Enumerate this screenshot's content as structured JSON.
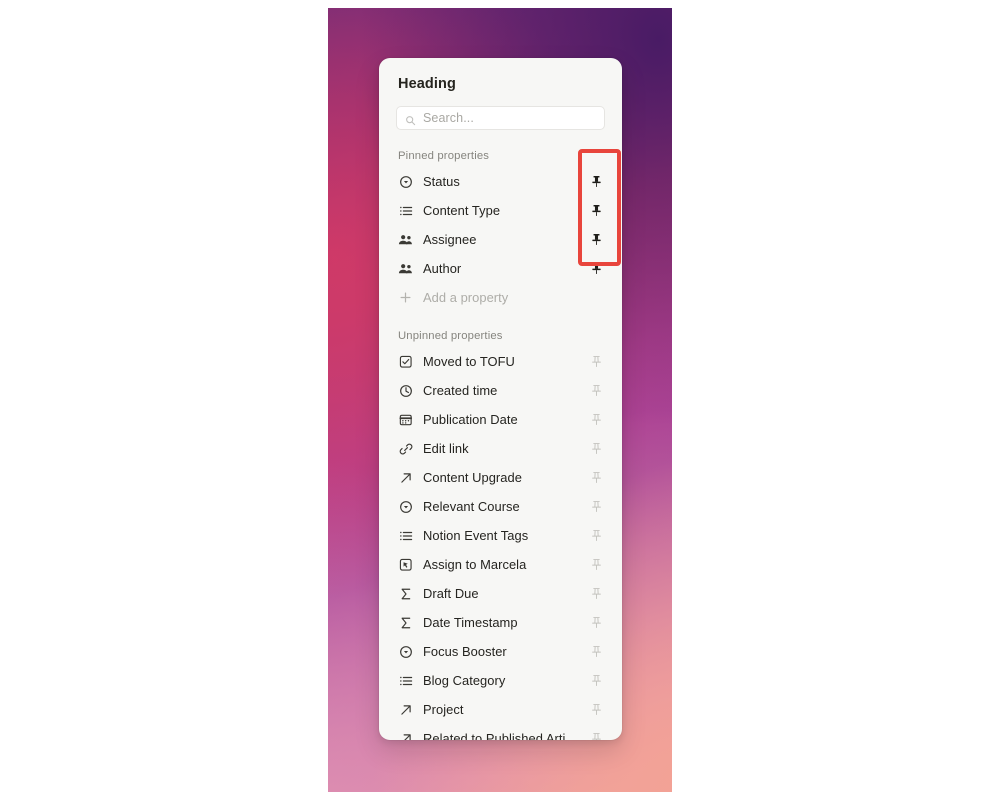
{
  "panel": {
    "heading": "Heading",
    "search": {
      "placeholder": "Search...",
      "value": "",
      "icon": "search-icon"
    },
    "pinned_section_label": "Pinned properties",
    "unpinned_section_label": "Unpinned properties",
    "add_property_label": "Add a property",
    "add_property_icon": "plus-icon"
  },
  "pinned_properties": [
    {
      "label": "Status",
      "icon": "select-icon",
      "pinned": true,
      "pin_icon": "pin-filled-icon"
    },
    {
      "label": "Content Type",
      "icon": "multiselect-icon",
      "pinned": true,
      "pin_icon": "pin-filled-icon"
    },
    {
      "label": "Assignee",
      "icon": "person-icon",
      "pinned": true,
      "pin_icon": "pin-filled-icon"
    },
    {
      "label": "Author",
      "icon": "person-icon",
      "pinned": true,
      "pin_icon": "pin-filled-icon"
    }
  ],
  "unpinned_properties": [
    {
      "label": "Moved to TOFU",
      "icon": "checkbox-icon",
      "pinned": false,
      "pin_icon": "pin-outline-icon"
    },
    {
      "label": "Created time",
      "icon": "clock-icon",
      "pinned": false,
      "pin_icon": "pin-outline-icon"
    },
    {
      "label": "Publication Date",
      "icon": "calendar-icon",
      "pinned": false,
      "pin_icon": "pin-outline-icon"
    },
    {
      "label": "Edit link",
      "icon": "link-icon",
      "pinned": false,
      "pin_icon": "pin-outline-icon"
    },
    {
      "label": "Content Upgrade",
      "icon": "relation-icon",
      "pinned": false,
      "pin_icon": "pin-outline-icon"
    },
    {
      "label": "Relevant Course",
      "icon": "select-icon",
      "pinned": false,
      "pin_icon": "pin-outline-icon"
    },
    {
      "label": "Notion Event Tags",
      "icon": "multiselect-icon",
      "pinned": false,
      "pin_icon": "pin-outline-icon"
    },
    {
      "label": "Assign to Marcela",
      "icon": "button-icon",
      "pinned": false,
      "pin_icon": "pin-outline-icon"
    },
    {
      "label": "Draft Due",
      "icon": "formula-icon",
      "pinned": false,
      "pin_icon": "pin-outline-icon"
    },
    {
      "label": "Date Timestamp",
      "icon": "formula-icon",
      "pinned": false,
      "pin_icon": "pin-outline-icon"
    },
    {
      "label": "Focus Booster",
      "icon": "select-icon",
      "pinned": false,
      "pin_icon": "pin-outline-icon"
    },
    {
      "label": "Blog Category",
      "icon": "multiselect-icon",
      "pinned": false,
      "pin_icon": "pin-outline-icon"
    },
    {
      "label": "Project",
      "icon": "relation-icon",
      "pinned": false,
      "pin_icon": "pin-outline-icon"
    },
    {
      "label": "Related to Published Article…",
      "icon": "relation-icon",
      "pinned": false,
      "pin_icon": "pin-outline-icon"
    }
  ],
  "annotation": {
    "name": "pinned-pins-highlight",
    "color": "#e8453c"
  },
  "colors": {
    "card_background": "#f7f7f5",
    "page_background": "#ffffff",
    "text_primary": "#252420",
    "text_muted": "#86857f",
    "pin_active": "#1f1e1a",
    "pin_inactive": "#c3c2bd",
    "highlight": "#e8453c"
  }
}
